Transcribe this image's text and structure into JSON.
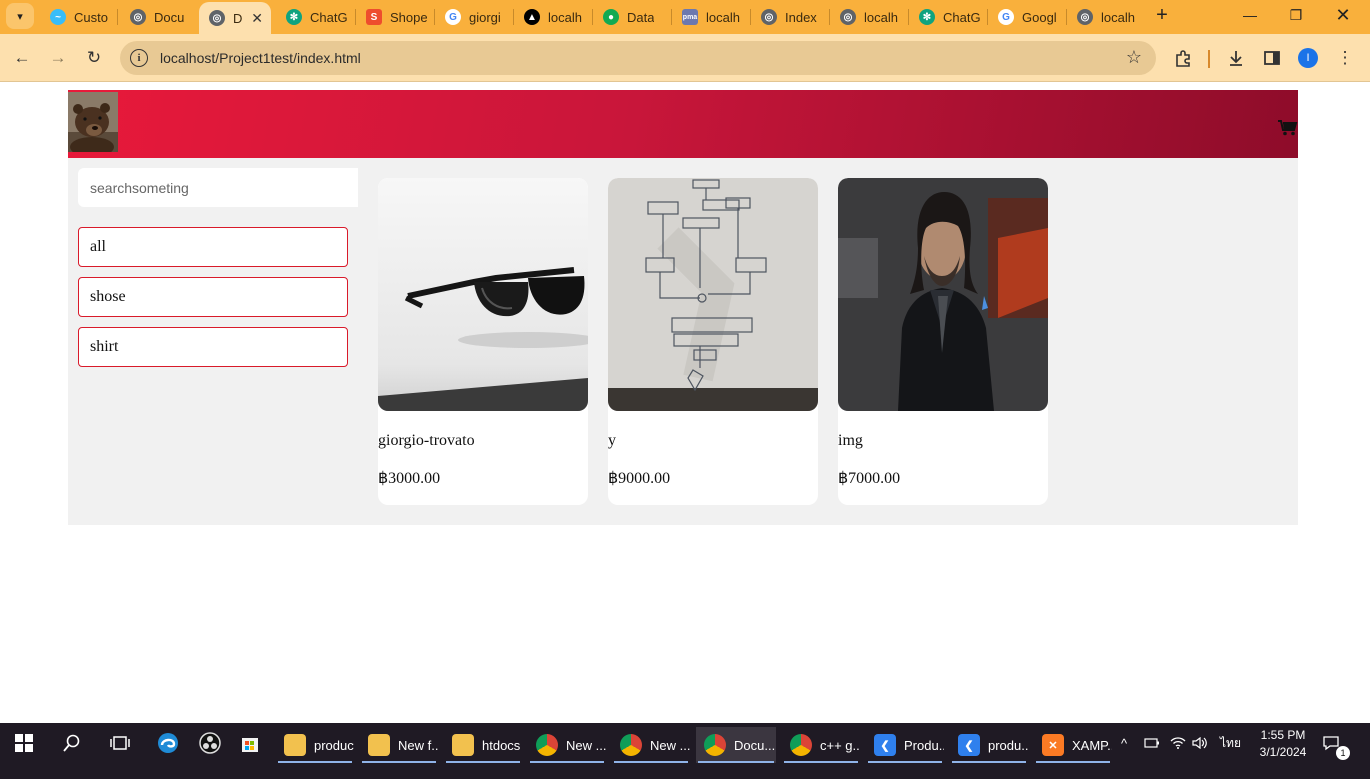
{
  "browser": {
    "tabs": [
      {
        "label": "Custo",
        "icon": "tailwind-icon",
        "color": "#38bdf8"
      },
      {
        "label": "Docu",
        "icon": "globe-icon",
        "color": "#5f6368"
      },
      {
        "label": "D",
        "icon": "globe-icon",
        "color": "#5f6368",
        "active": true
      },
      {
        "label": "ChatG",
        "icon": "chatgpt-icon",
        "color": "#10a37f"
      },
      {
        "label": "Shope",
        "icon": "shopee-icon",
        "color": "#ee4d2d"
      },
      {
        "label": "giorgi",
        "icon": "google-icon",
        "color": "#4285f4"
      },
      {
        "label": "localh",
        "icon": "vercel-icon",
        "color": "#000000"
      },
      {
        "label": "Data",
        "icon": "mongodb-icon",
        "color": "#13aa52"
      },
      {
        "label": "localh",
        "icon": "phpmyadmin-icon",
        "color": "#6c78af"
      },
      {
        "label": "Index",
        "icon": "globe-icon",
        "color": "#5f6368"
      },
      {
        "label": "localh",
        "icon": "globe-icon",
        "color": "#5f6368"
      },
      {
        "label": "ChatG",
        "icon": "chatgpt-icon",
        "color": "#10a37f"
      },
      {
        "label": "Googl",
        "icon": "google-icon",
        "color": "#4285f4"
      },
      {
        "label": "localh",
        "icon": "globe-icon",
        "color": "#5f6368"
      }
    ],
    "active_tab_close": "✕",
    "new_tab": "+",
    "url": "localhost/Project1test/index.html",
    "profile_initial": "I"
  },
  "page": {
    "search_placeholder": "searchsometing",
    "categories": [
      "all",
      "shose",
      "shirt"
    ],
    "products": [
      {
        "name": "giorgio-trovato",
        "price": "฿3000.00"
      },
      {
        "name": "y",
        "price": "฿9000.00"
      },
      {
        "name": "img",
        "price": "฿7000.00"
      }
    ],
    "accent_color": "#e8193a"
  },
  "taskbar": {
    "apps": [
      {
        "label": "product",
        "icon": "folder-icon",
        "color": "#f2c14e"
      },
      {
        "label": "New f...",
        "icon": "folder-icon",
        "color": "#f2c14e"
      },
      {
        "label": "htdocs",
        "icon": "folder-icon",
        "color": "#f2c14e"
      },
      {
        "label": "New ...",
        "icon": "chrome-icon",
        "color": "#db4437"
      },
      {
        "label": "New ...",
        "icon": "chrome-icon",
        "color": "#db4437"
      },
      {
        "label": "Docu...",
        "icon": "chrome-icon",
        "color": "#db4437",
        "active": true
      },
      {
        "label": "c++ g...",
        "icon": "chrome-icon",
        "color": "#db4437"
      },
      {
        "label": "Produ...",
        "icon": "vscode-icon",
        "color": "#2f80ed"
      },
      {
        "label": "produ...",
        "icon": "vscode-icon",
        "color": "#2f80ed"
      },
      {
        "label": "XAMP...",
        "icon": "xampp-icon",
        "color": "#fb7a24"
      }
    ],
    "keyboard_lang": "ไทย",
    "time": "1:55 PM",
    "date": "3/1/2024",
    "notification_count": "1"
  }
}
